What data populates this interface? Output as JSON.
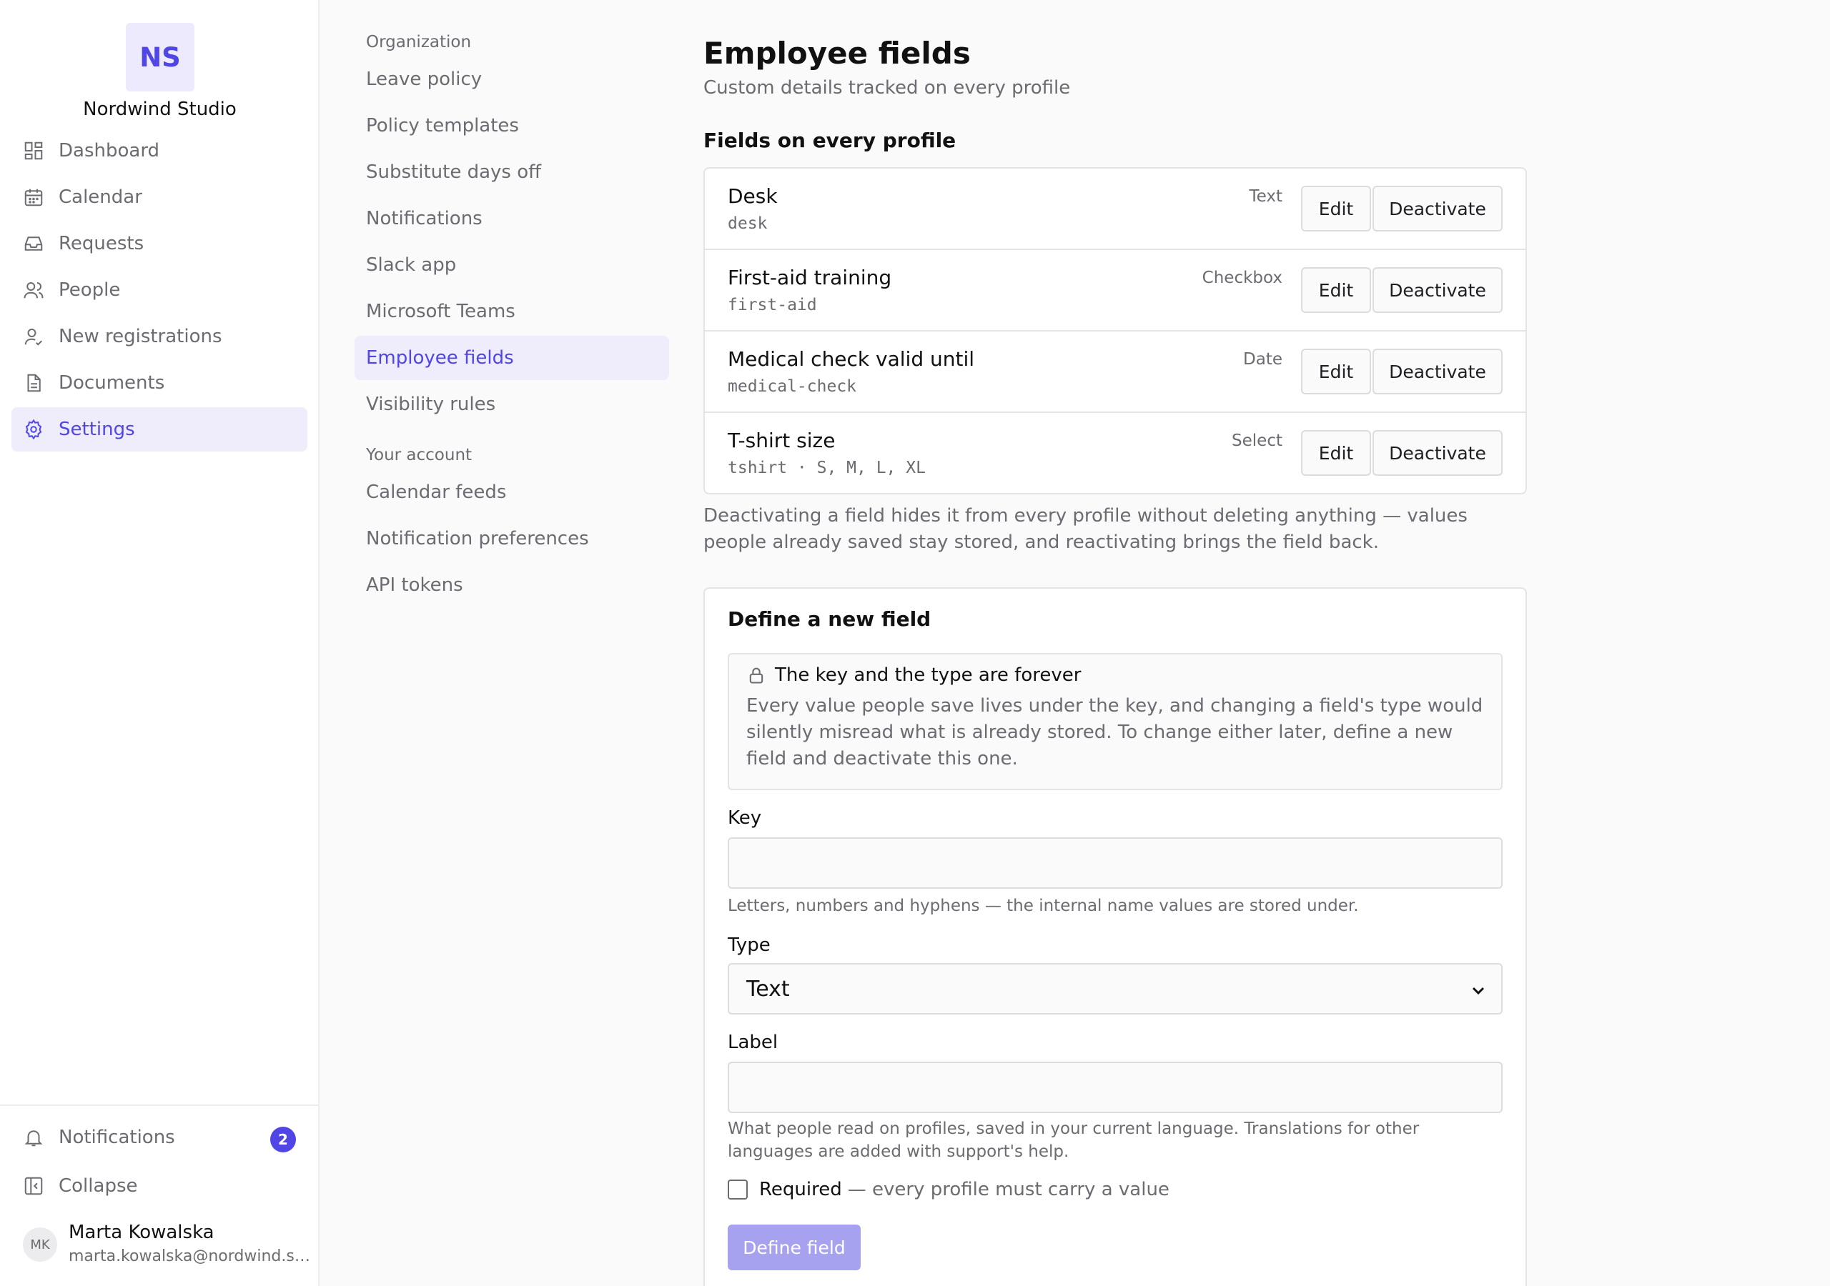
{
  "org": {
    "initials": "NS",
    "name": "Nordwind Studio"
  },
  "nav": {
    "items": [
      {
        "label": "Dashboard",
        "icon": "dashboard-icon"
      },
      {
        "label": "Calendar",
        "icon": "calendar-icon"
      },
      {
        "label": "Requests",
        "icon": "inbox-icon"
      },
      {
        "label": "People",
        "icon": "people-icon"
      },
      {
        "label": "New registrations",
        "icon": "user-check-icon"
      },
      {
        "label": "Documents",
        "icon": "document-icon"
      },
      {
        "label": "Settings",
        "icon": "gear-icon",
        "active": true
      }
    ],
    "notifications_label": "Notifications",
    "notifications_count": "2",
    "collapse_label": "Collapse"
  },
  "user": {
    "initials": "MK",
    "name": "Marta Kowalska",
    "email": "marta.kowalska@nordwind.studio"
  },
  "subnav": {
    "organization_heading": "Organization",
    "organization_items": [
      "Leave policy",
      "Policy templates",
      "Substitute days off",
      "Notifications",
      "Slack app",
      "Microsoft Teams",
      "Employee fields",
      "Visibility rules"
    ],
    "active": "Employee fields",
    "account_heading": "Your account",
    "account_items": [
      "Calendar feeds",
      "Notification preferences",
      "API tokens"
    ]
  },
  "main": {
    "title": "Employee fields",
    "subtitle": "Custom details tracked on every profile",
    "fields_title": "Fields on every profile",
    "edit_label": "Edit",
    "deactivate_label": "Deactivate",
    "fields": [
      {
        "label": "Desk",
        "key": "desk",
        "type": "Text"
      },
      {
        "label": "First-aid training",
        "key": "first-aid",
        "type": "Checkbox"
      },
      {
        "label": "Medical check valid until",
        "key": "medical-check",
        "type": "Date"
      },
      {
        "label": "T-shirt size",
        "key": "tshirt · S, M, L, XL",
        "type": "Select"
      }
    ],
    "fields_note": "Deactivating a field hides it from every profile without deleting anything — values people already saved stay stored, and reactivating brings the field back.",
    "define": {
      "title": "Define a new field",
      "notice_title": "The key and the type are forever",
      "notice_body": "Every value people save lives under the key, and changing a field's type would silently misread what is already stored. To change either later, define a new field and deactivate this one.",
      "key_label": "Key",
      "key_value": "",
      "key_help": "Letters, numbers and hyphens — the internal name values are stored under.",
      "type_label": "Type",
      "type_value": "Text",
      "label_label": "Label",
      "label_value": "",
      "label_help": "What people read on profiles, saved in your current language. Translations for other languages are added with support's help.",
      "required_label": "Required",
      "required_desc": "— every profile must carry a value",
      "submit_label": "Define field"
    }
  }
}
